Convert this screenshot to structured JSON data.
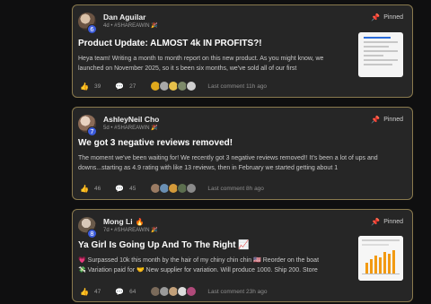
{
  "posts": [
    {
      "author": "Dan Aguilar",
      "level": "6",
      "meta": "4d • #SHAREAWIN 🎉",
      "pinned_label": "Pinned",
      "title": "Product Update: ALMOST 4k IN PROFITS?!",
      "body": "Heya team! Writing a month to month report on this new product. As you might know, we launched on November 2025, so it s been six months, we've sold all of our first",
      "likes": "39",
      "comments": "27",
      "last_comment": "Last comment 11h ago",
      "commenter_colors": [
        "#e0a91c",
        "#a8a8a8",
        "#e6c04a",
        "#7d8a6a",
        "#cfcfcf"
      ]
    },
    {
      "author": "AshleyNeil Cho",
      "level": "7",
      "meta": "5d • #SHAREAWIN 🎉",
      "pinned_label": "Pinned",
      "title": "We got 3 negative reviews removed!",
      "body": "The moment we've been waiting for! We recently got 3 negative reviews removed!! It's been a lot of ups and downs...starting as 4.9 rating with like 13 reviews, then in February we started getting about 1",
      "likes": "46",
      "comments": "45",
      "last_comment": "Last comment 8h ago",
      "commenter_colors": [
        "#9a7b63",
        "#6a8fb3",
        "#d49a3a",
        "#5c6f4f",
        "#8a8a8a"
      ]
    },
    {
      "author": "Mong Li",
      "level": "8",
      "meta": "7d • #SHAREAWIN 🎉",
      "pinned_label": "Pinned",
      "title": "Ya Girl Is Going Up And To The Right 📈",
      "body_line1": "💗 Surpassed 10k this month by the hair of my chiny chin chin 🇺🇸 Reorder on the boat",
      "body_line2": "💸 Variation paid for 🤝 New supplier for variation. Will produce 1000. Ship 200. Store",
      "likes": "47",
      "comments": "64",
      "last_comment": "Last comment 23h ago",
      "commenter_colors": [
        "#7a6a5a",
        "#9a9a9a",
        "#c2a07a",
        "#dcdcdc",
        "#b04a7a"
      ]
    }
  ],
  "icons": {
    "like": "thumbs-up-icon",
    "comment": "comment-icon",
    "pin": "pin-icon"
  }
}
